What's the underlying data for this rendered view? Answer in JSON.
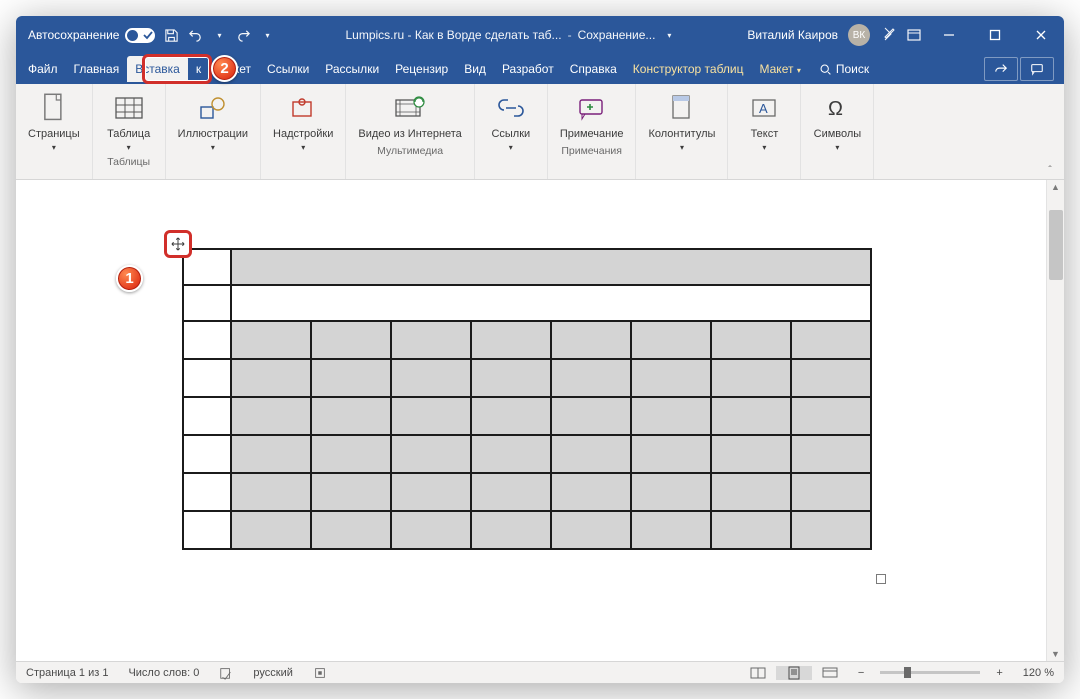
{
  "title": {
    "autosave": "Автосохранение",
    "doc": "Lumpics.ru - Как в Ворде сделать таб...",
    "saving": "Сохранение...",
    "user": "Виталий Каиров",
    "avatar": "ВК"
  },
  "tabs": {
    "file": "Файл",
    "home": "Главная",
    "insert": "Вставка",
    "draw": "к",
    "layout": "Макет",
    "references": "Ссылки",
    "mailings": "Рассылки",
    "review": "Рецензир",
    "view": "Вид",
    "developer": "Разработ",
    "help": "Справка",
    "table_design": "Конструктор таблиц",
    "table_layout": "Макет",
    "search": "Поиск"
  },
  "ribbon": {
    "pages": {
      "label": "Страницы"
    },
    "table": {
      "label": "Таблица",
      "group": "Таблицы"
    },
    "illustrations": {
      "label": "Иллюстрации"
    },
    "addins": {
      "label": "Надстройки"
    },
    "media": {
      "label": "Видео из Интернета",
      "group": "Мультимедиа"
    },
    "links": {
      "label": "Ссылки"
    },
    "comments": {
      "label": "Примечание",
      "group": "Примечания"
    },
    "headers": {
      "label": "Колонтитулы"
    },
    "text": {
      "label": "Текст"
    },
    "symbols": {
      "label": "Символы"
    }
  },
  "status": {
    "page": "Страница 1 из 1",
    "words": "Число слов: 0",
    "lang": "русский",
    "zoom": "120 %"
  },
  "icons": {
    "chevron_down": "▾",
    "minus": "−",
    "plus": "+"
  },
  "colors": {
    "brand": "#2b579a",
    "callout": "#e33b1e"
  }
}
